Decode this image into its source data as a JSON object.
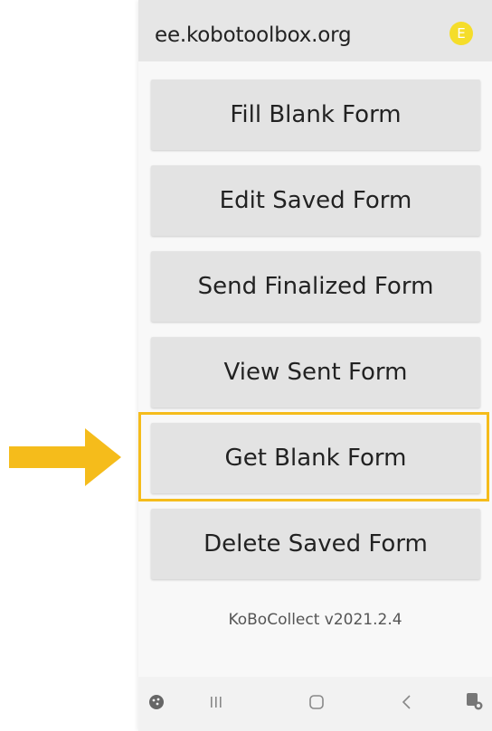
{
  "topbar": {
    "server_url": "ee.kobotoolbox.org",
    "avatar_letter": "E",
    "avatar_color": "#f5dd2a"
  },
  "menu": {
    "fill_blank_form": "Fill Blank Form",
    "edit_saved_form": "Edit Saved Form",
    "send_finalized_form": "Send Finalized Form",
    "view_sent_form": "View Sent Form",
    "get_blank_form": "Get Blank Form",
    "delete_saved_form": "Delete Saved Form"
  },
  "highlight": {
    "target": "Get Blank Form",
    "color": "#f5bc1b"
  },
  "footer": {
    "version": "KoBoCollect v2021.2.4"
  },
  "navbar": {
    "icons": [
      "dots-icon",
      "recent-apps-icon",
      "home-icon",
      "back-icon",
      "accessibility-icon"
    ]
  }
}
